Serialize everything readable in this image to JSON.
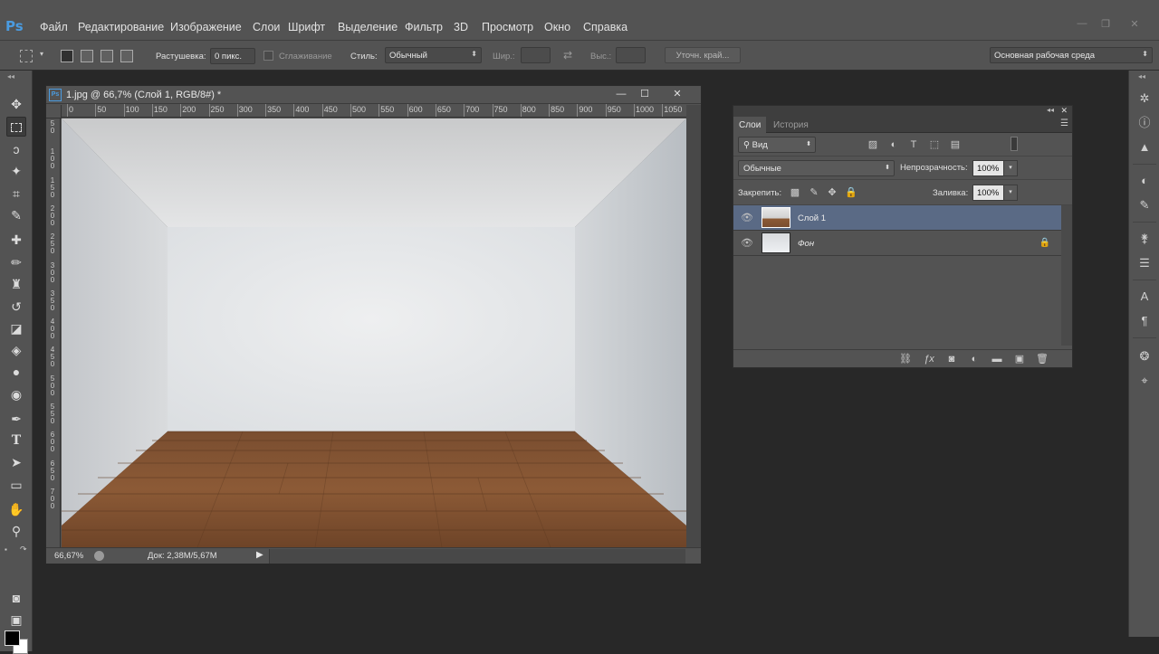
{
  "app": {
    "logo": "Ps"
  },
  "menu": [
    "Файл",
    "Редактирование",
    "Изображение",
    "Слои",
    "Шрифт",
    "Выделение",
    "Фильтр",
    "3D",
    "Просмотр",
    "Окно",
    "Справка"
  ],
  "window_controls": {
    "minimize": "—",
    "restore": "❐",
    "close": "✕"
  },
  "options": {
    "feather_label": "Растушевка:",
    "feather_value": "0 пикс.",
    "antialias_label": "Сглаживание",
    "style_label": "Стиль:",
    "style_value": "Обычный",
    "width_label": "Шир.:",
    "height_label": "Выс.:",
    "refine_edge": "Уточн. край...",
    "workspace": "Основная рабочая среда"
  },
  "document": {
    "title": "1.jpg @ 66,7% (Слой 1, RGB/8#) *",
    "icon_text": "Ps",
    "zoom": "66,67%",
    "status": "Док: 2,38M/5,67M",
    "ruler_top": [
      "0",
      "50",
      "100",
      "150",
      "200",
      "250",
      "300",
      "350",
      "400",
      "450",
      "500",
      "550",
      "600",
      "650",
      "700",
      "750",
      "800",
      "850",
      "900",
      "950",
      "1000",
      "1050"
    ],
    "ruler_left": [
      "5\n0",
      "1\n0\n0",
      "1\n5\n0",
      "2\n0\n0",
      "2\n5\n0",
      "3\n0\n0",
      "3\n5\n0",
      "4\n0\n0",
      "4\n5\n0",
      "5\n0\n0",
      "5\n5\n0",
      "6\n0\n0",
      "6\n5\n0",
      "7\n0\n0"
    ]
  },
  "layers_panel": {
    "tabs": [
      "Слои",
      "История"
    ],
    "filter": "Вид",
    "blend_mode": "Обычные",
    "opacity_label": "Непрозрачность:",
    "opacity_value": "100%",
    "lock_label": "Закрепить:",
    "fill_label": "Заливка:",
    "fill_value": "100%",
    "layers": [
      {
        "name": "Слой 1",
        "selected": true
      },
      {
        "name": "Фон",
        "locked": true
      }
    ]
  },
  "colors": {
    "foreground": "#000000",
    "background": "#ffffff",
    "selection": "#5a6a85",
    "accent": "#4a9be0"
  }
}
